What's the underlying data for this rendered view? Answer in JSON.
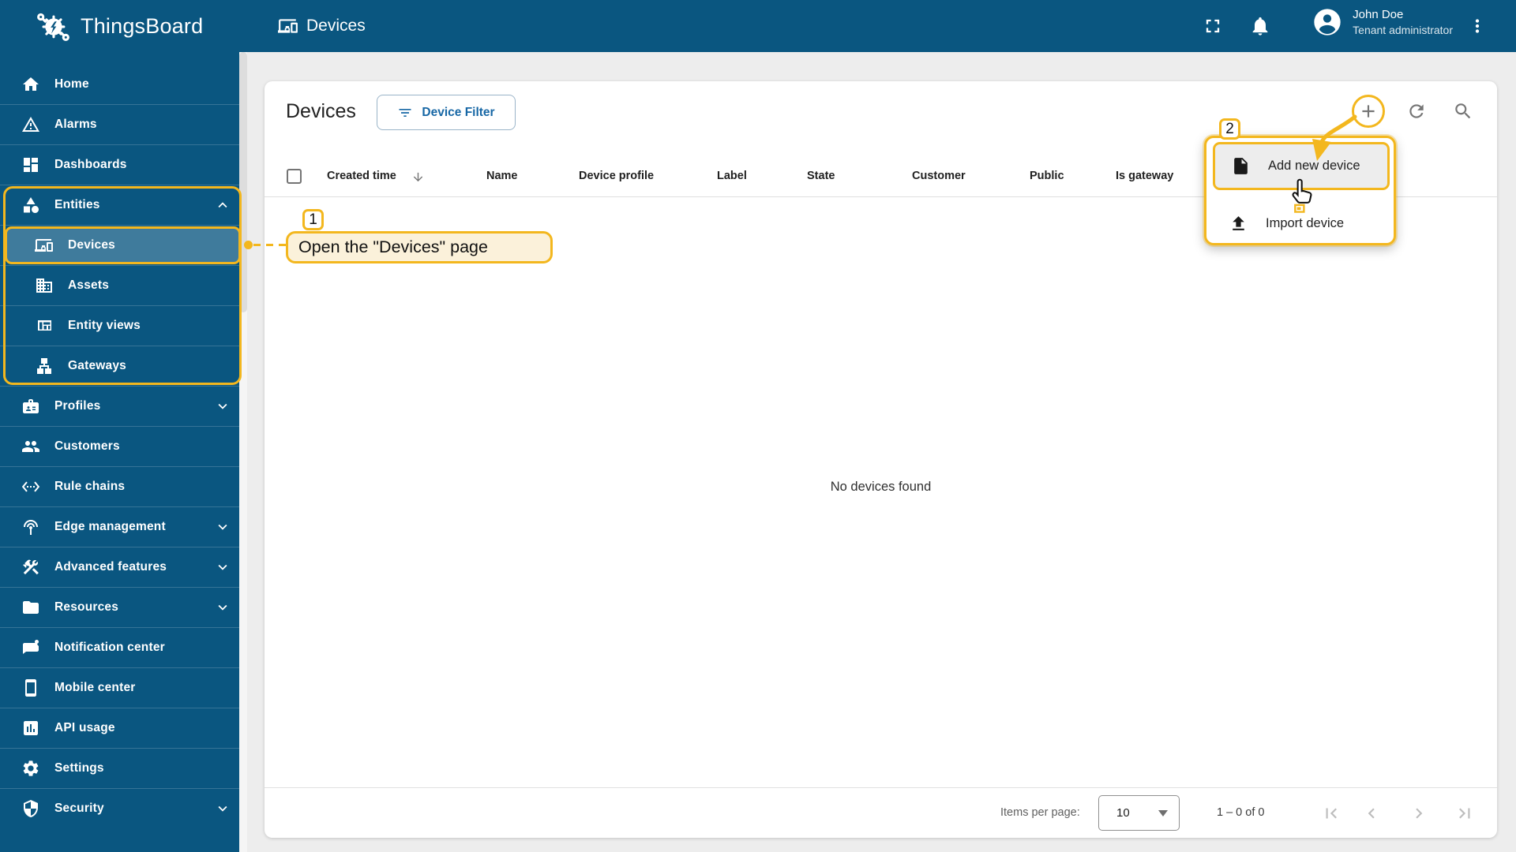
{
  "colors": {
    "primary": "#0A5680",
    "selected_item_bg": "#46768F",
    "annotation_yellow": "#F3B71E",
    "annotation_fill": "#FBF1DA",
    "accent_blue": "#1767A5",
    "main_bg": "#EDEDED",
    "card_bg": "#FFFFFF"
  },
  "topbar": {
    "brand": "ThingsBoard",
    "page_title": "Devices",
    "user": {
      "name": "John Doe",
      "role": "Tenant administrator"
    }
  },
  "sidebar": {
    "items": [
      {
        "label": "Home",
        "icon": "home-icon"
      },
      {
        "label": "Alarms",
        "icon": "warning-icon"
      },
      {
        "label": "Dashboards",
        "icon": "dashboard-icon"
      },
      {
        "label": "Entities",
        "icon": "category-icon",
        "expanded": true
      },
      {
        "label": "Devices",
        "icon": "devices-icon",
        "selected": true
      },
      {
        "label": "Assets",
        "icon": "building-icon"
      },
      {
        "label": "Entity views",
        "icon": "grid-icon"
      },
      {
        "label": "Gateways",
        "icon": "lan-icon"
      },
      {
        "label": "Profiles",
        "icon": "badge-icon",
        "collapsible": true
      },
      {
        "label": "Customers",
        "icon": "people-icon"
      },
      {
        "label": "Rule chains",
        "icon": "ethernet-icon"
      },
      {
        "label": "Edge management",
        "icon": "antenna-icon",
        "collapsible": true
      },
      {
        "label": "Advanced features",
        "icon": "tools-icon",
        "collapsible": true
      },
      {
        "label": "Resources",
        "icon": "folder-icon",
        "collapsible": true
      },
      {
        "label": "Notification center",
        "icon": "chat-icon"
      },
      {
        "label": "Mobile center",
        "icon": "smartphone-icon"
      },
      {
        "label": "API usage",
        "icon": "chart-icon"
      },
      {
        "label": "Settings",
        "icon": "gear-icon"
      },
      {
        "label": "Security",
        "icon": "shield-icon",
        "collapsible": true
      }
    ]
  },
  "main": {
    "title": "Devices",
    "filter_button_label": "Device Filter",
    "columns": [
      "Created time",
      "Name",
      "Device profile",
      "Label",
      "State",
      "Customer",
      "Public",
      "Is gateway"
    ],
    "empty_text": "No devices found",
    "pagination": {
      "items_per_page_label": "Items per page:",
      "page_size": "10",
      "range_label": "1 – 0 of 0"
    }
  },
  "menu": {
    "items": [
      {
        "label": "Add new device",
        "icon": "file-icon"
      },
      {
        "label": "Import device",
        "icon": "upload-icon"
      }
    ]
  },
  "annotations": {
    "step1": {
      "number": "1",
      "label": "Open the \"Devices\" page"
    },
    "step2": {
      "number": "2"
    }
  }
}
